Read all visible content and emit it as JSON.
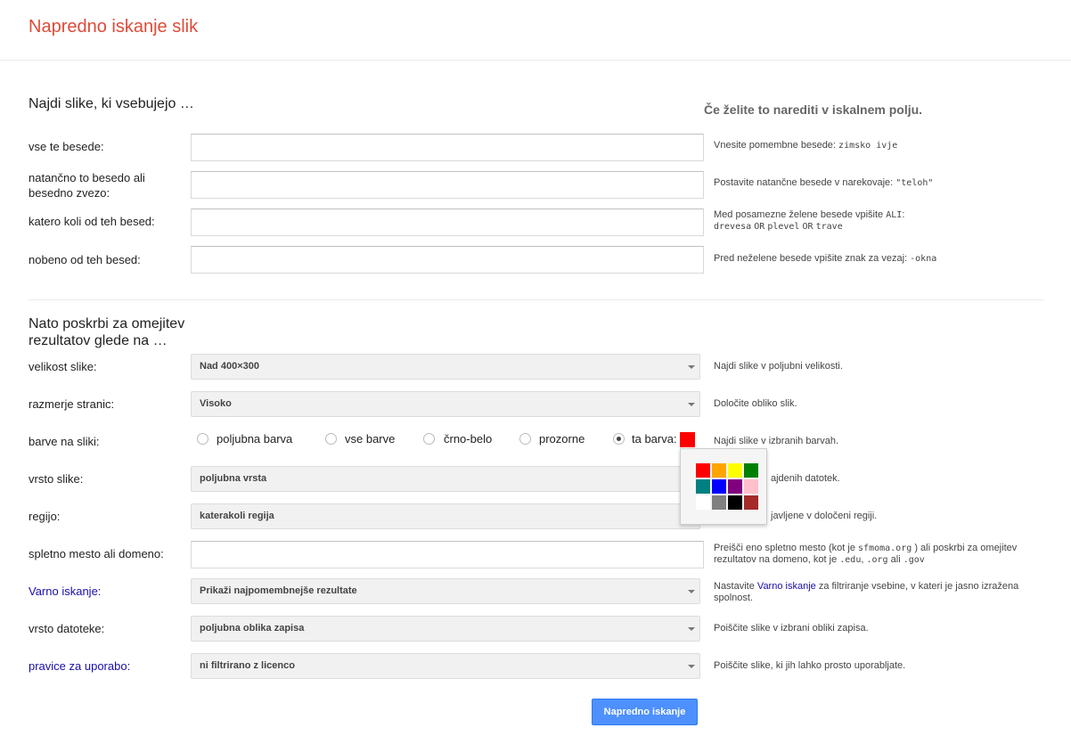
{
  "header": {
    "title": "Napredno iskanje slik"
  },
  "section1": {
    "title": "Najdi slike, ki vsebujejo …",
    "help_title": "Če želite to narediti v iskalnem polju.",
    "fields": [
      {
        "label": "vse te besede:",
        "value": "",
        "hint_text": "Vnesite pomembne besede:",
        "hint_code": "zimsko ivje"
      },
      {
        "label": "natančno to besedo ali besedno zvezo:",
        "value": "",
        "hint_text": "Postavite natančne besede v narekovaje:",
        "hint_code": "\"teloh\""
      },
      {
        "label": "katero koli od teh besed:",
        "value": "",
        "hint_text": "Med posamezne želene besede vpišite",
        "hint_code": "ALI",
        "hint_colon": ":",
        "hint_line2": [
          "drevesa",
          "OR",
          "plevel",
          "OR",
          "trave"
        ]
      },
      {
        "label": "nobeno od teh besed:",
        "value": "",
        "hint_text": "Pred neželene besede vpišite znak za vezaj:",
        "hint_code": "-okna"
      }
    ]
  },
  "section2": {
    "title": "Nato poskrbi za omejitev rezultatov glede na …",
    "size": {
      "label": "velikost slike:",
      "value": "Nad 400×300",
      "hint": "Najdi slike v poljubni velikosti."
    },
    "aspect": {
      "label": "razmerje stranic:",
      "value": "Visoko",
      "hint": "Določite obliko slik."
    },
    "colors": {
      "label": "barve na sliki:",
      "options": [
        "poljubna barva",
        "vse barve",
        "črno-belo",
        "prozorne",
        "ta barva:"
      ],
      "selected": "ta barva:",
      "selected_color": "#ff0000",
      "hint": "Najdi slike v izbranih barvah.",
      "palette": [
        "#ff0000",
        "#ffa500",
        "#ffff00",
        "#008000",
        "#008080",
        "#0000ff",
        "#800080",
        "#ffc0cb",
        "#ffffff",
        "#808080",
        "#000000",
        "#a52a2a"
      ]
    },
    "type": {
      "label": "vrsto slike:",
      "value": "poljubna vrsta",
      "hint": "ajdenih datotek."
    },
    "region": {
      "label": "regijo:",
      "value": "katerakoli regija",
      "hint": "javljene v določeni regiji."
    },
    "site": {
      "label": "spletno mesto ali domeno:",
      "value": "",
      "hint_a": "Preišči eno spletno mesto (kot je",
      "hint_code1": "sfmoma.org",
      "hint_b": ") ali poskrbi za omejitev rezultatov na domeno, kot je",
      "hint_code2": ".edu",
      "hint_c": ",",
      "hint_code3": ".org",
      "hint_d": "ali",
      "hint_code4": ".gov"
    },
    "safe": {
      "label": "Varno iskanje:",
      "value": "Prikaži najpomembnejše rezultate",
      "hint_a": "Nastavite",
      "hint_link": "Varno iskanje",
      "hint_b": "za filtriranje vsebine, v kateri je jasno izražena spolnost."
    },
    "filetype": {
      "label": "vrsto datoteke:",
      "value": "poljubna oblika zapisa",
      "hint": "Poiščite slike v izbrani obliki zapisa."
    },
    "rights": {
      "label": "pravice za uporabo:",
      "value": "ni filtrirano z licenco",
      "hint": "Poiščite slike, ki jih lahko prosto uporabljate."
    }
  },
  "submit_label": "Napredno iskanje"
}
